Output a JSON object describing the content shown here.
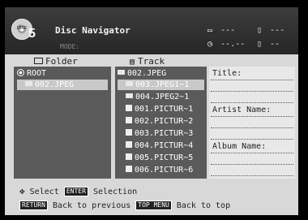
{
  "header": {
    "disc_label": "disc",
    "disc_number": "5",
    "title": "Disc Navigator",
    "mode": "MODE:",
    "info": {
      "folder_count": "---",
      "file_count": "---",
      "time": "--.--",
      "track": "--"
    }
  },
  "left": {
    "header": "Folder",
    "items": [
      {
        "label": "ROOT",
        "icon": "radio-icon",
        "selected": false
      },
      {
        "label": "002.JPEG",
        "icon": "folder-icon",
        "selected": true
      }
    ]
  },
  "middle": {
    "header": "Track",
    "items": [
      {
        "label": "002.JPEG",
        "icon": "folder-icon",
        "selected": false
      },
      {
        "label": "003.JPEG1~1",
        "icon": "folder-icon",
        "selected": true
      },
      {
        "label": "004.JPEG2~1",
        "icon": "folder-icon",
        "selected": false
      },
      {
        "label": "001.PICTUR~1",
        "icon": "picture-icon",
        "selected": false
      },
      {
        "label": "002.PICTUR~2",
        "icon": "picture-icon",
        "selected": false
      },
      {
        "label": "003.PICTUR~3",
        "icon": "picture-icon",
        "selected": false
      },
      {
        "label": "004.PICTUR~4",
        "icon": "picture-icon",
        "selected": false
      },
      {
        "label": "005.PICTUR~5",
        "icon": "picture-icon",
        "selected": false
      },
      {
        "label": "006.PICTUR~6",
        "icon": "picture-icon",
        "selected": false
      }
    ]
  },
  "right": {
    "title_label": "Title:",
    "artist_label": "Artist Name:",
    "album_label": "Album Name:"
  },
  "footer": {
    "select_label": "Select",
    "enter_key": "ENTER",
    "enter_label": "Selection",
    "return_key": "RETURN",
    "return_label": "Back to previous",
    "topmenu_key": "TOP MENU",
    "topmenu_label": "Back to top"
  }
}
